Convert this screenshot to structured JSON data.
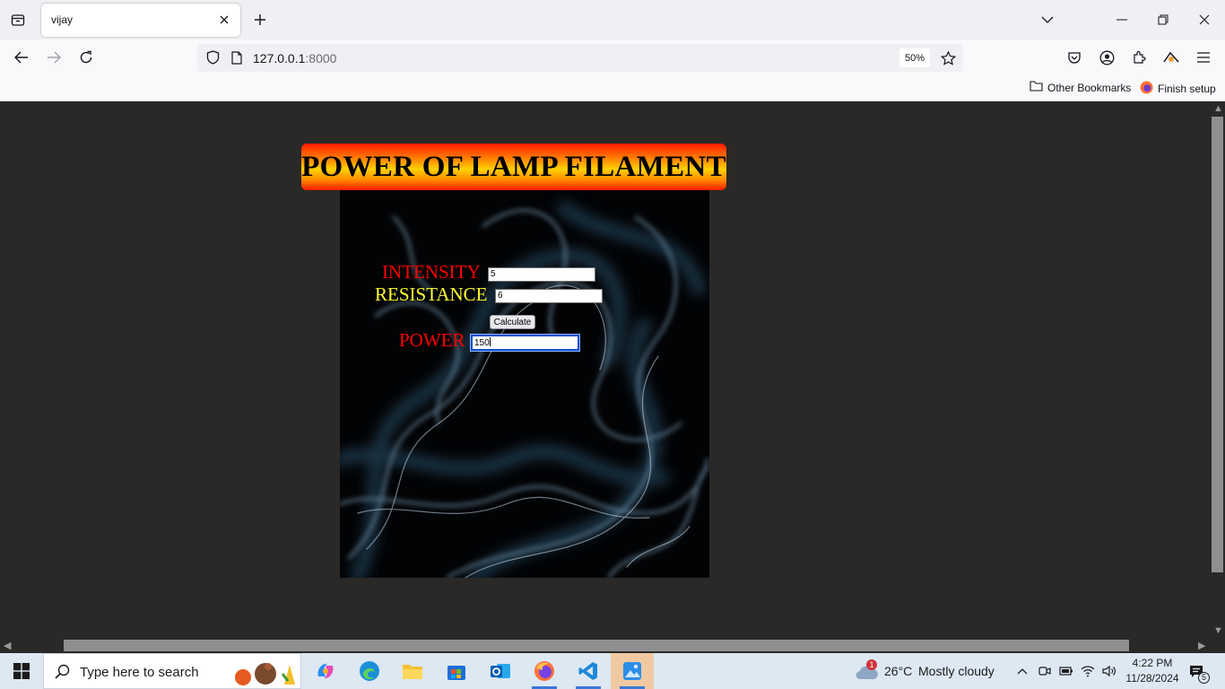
{
  "browser": {
    "tab_title": "vijay",
    "url_host": "127.0.0.1",
    "url_port": ":8000",
    "zoom": "50%",
    "bookmarks": [
      "Other Bookmarks",
      "Finish setup"
    ]
  },
  "page": {
    "title": "POWER OF LAMP FILAMENT",
    "intensity_label": "INTENSITY",
    "intensity_value": "5",
    "resistance_label": "RESISTANCE",
    "resistance_value": "6",
    "calculate_label": "Calculate",
    "power_label": "POWER",
    "power_value": "150",
    "colors": {
      "intensity_label": "#ff0000",
      "resistance_label": "#ffff33",
      "power_label": "#ff0000"
    }
  },
  "taskbar": {
    "search_placeholder": "Type here to search",
    "weather_temp": "26°C",
    "weather_text": "Mostly cloudy",
    "weather_badge": "1",
    "time": "4:22 PM",
    "date": "11/28/2024",
    "notification_count": "5"
  }
}
